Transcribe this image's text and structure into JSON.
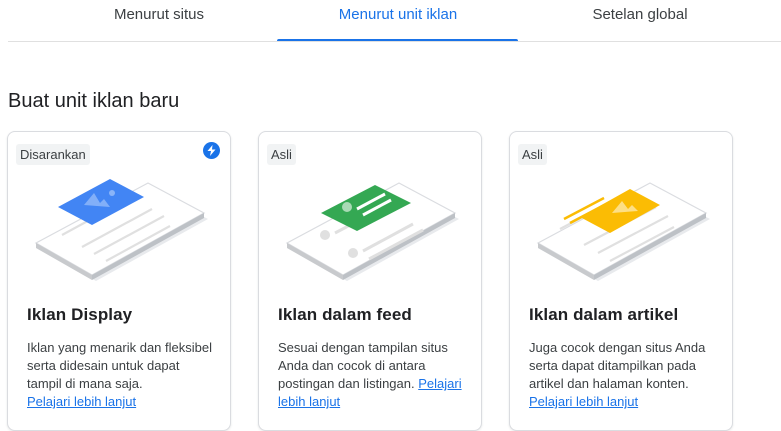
{
  "tabs": [
    {
      "label": "Menurut situs"
    },
    {
      "label": "Menurut unit iklan"
    },
    {
      "label": "Setelan global"
    }
  ],
  "active_tab": "Menurut unit iklan",
  "section_title": "Buat unit iklan baru",
  "cards": [
    {
      "badge": "Disarankan",
      "title": "Iklan Display",
      "description": "Iklan yang menarik dan fleksibel serta didesain untuk dapat tampil di mana saja.",
      "link": "Pelajari lebih lanjut",
      "accent": "#4285f4",
      "illustration": "display-ad-illustration"
    },
    {
      "badge": "Asli",
      "title": "Iklan dalam feed",
      "description": "Sesuai dengan tampilan situs Anda dan cocok di antara postingan dan listingan.",
      "link": "Pelajari lebih lanjut",
      "accent": "#34a853",
      "illustration": "in-feed-ad-illustration"
    },
    {
      "badge": "Asli",
      "title": "Iklan dalam artikel",
      "description": "Juga cocok dengan situs Anda serta dapat ditampilkan pada artikel dan halaman konten.",
      "link": "Pelajari lebih lanjut",
      "accent": "#fbbc04",
      "illustration": "in-article-ad-illustration"
    }
  ],
  "colors": {
    "primary": "#1a73e8",
    "border": "#dadce0",
    "badge_bg": "#f1f3f4"
  },
  "icons": {
    "recommended": "bolt-icon"
  }
}
